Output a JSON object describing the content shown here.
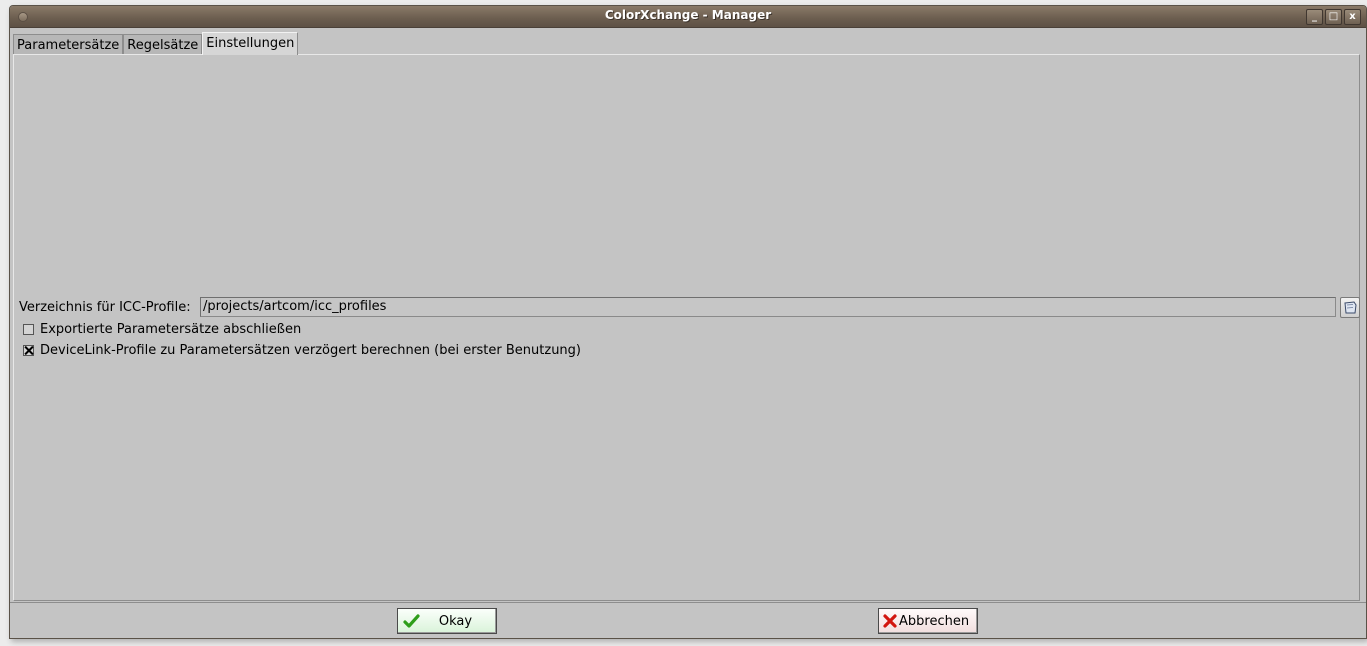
{
  "window": {
    "title": "ColorXchange - Manager",
    "controls": [
      "_",
      "□",
      "x"
    ]
  },
  "tabs": [
    {
      "label": "Parametersätze",
      "active": false
    },
    {
      "label": "Regelsätze",
      "active": false
    },
    {
      "label": "Einstellungen",
      "active": true
    }
  ],
  "settings": {
    "icc_dir_label": "Verzeichnis für ICC-Profile:",
    "icc_dir_value": "/projects/artcom/icc_profiles",
    "checkboxes": [
      {
        "label": "Exportierte Parametersätze abschließen",
        "checked": false
      },
      {
        "label": "DeviceLink-Profile zu Parametersätzen verzögert berechnen (bei erster Benutzung)",
        "checked": true
      }
    ]
  },
  "buttons": {
    "okay": "Okay",
    "cancel": "Abbrechen"
  },
  "colors": {
    "titlebar": "#6b5d4f",
    "panel": "#c4c4c4",
    "okay_icon": "#2e9e1a",
    "cancel_icon": "#d2160f"
  },
  "icons": {
    "browse": "folder-browse-icon",
    "okay": "checkmark-icon",
    "cancel": "red-x-icon"
  }
}
